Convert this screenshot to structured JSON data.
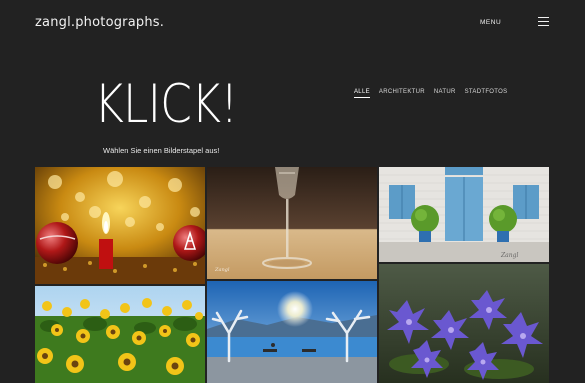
{
  "header": {
    "logo": "zangl.photographs.",
    "menu_label": "MENU"
  },
  "hero": {
    "title": "KLICK!",
    "subtitle": "Wählen Sie einen Bilderstapel aus!"
  },
  "filters": [
    {
      "label": "ALLE",
      "active": true
    },
    {
      "label": "ARCHITEKTUR",
      "active": false
    },
    {
      "label": "NATUR",
      "active": false
    },
    {
      "label": "STADTFOTOS",
      "active": false
    }
  ],
  "gallery": [
    {
      "subject": "christmas-candle-ornaments"
    },
    {
      "subject": "champagne-glass"
    },
    {
      "subject": "blue-shutters-house"
    },
    {
      "subject": "sunflower-field"
    },
    {
      "subject": "lakeside-promenade-trees"
    },
    {
      "subject": "purple-flowers"
    }
  ],
  "signatures": {
    "glass": "Zangl",
    "house": "Zangl"
  },
  "colors": {
    "background": "#222222",
    "text": "#ffffff"
  }
}
